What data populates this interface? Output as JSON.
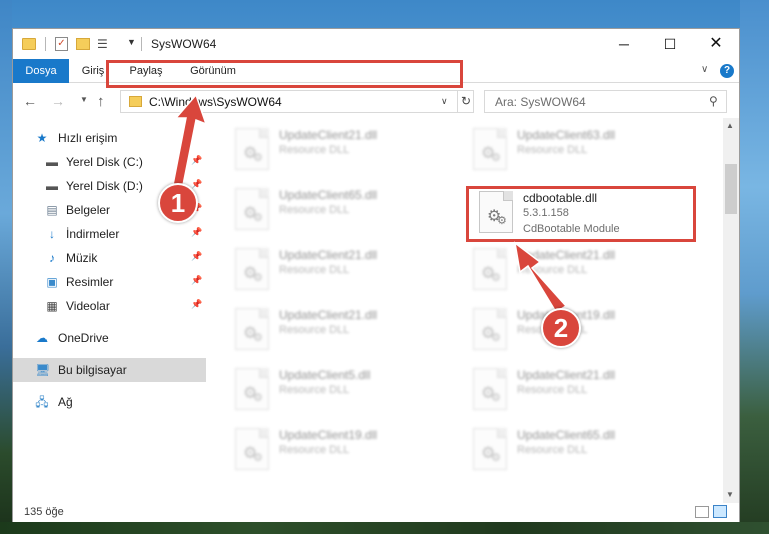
{
  "window": {
    "title": "SysWOW64",
    "minimize_glyph": "─",
    "maximize_glyph": "☐",
    "close_glyph": "✕"
  },
  "ribbon": {
    "tabs": [
      "Dosya",
      "Giriş",
      "Paylaş",
      "Görünüm"
    ],
    "help_glyph": "?"
  },
  "navigation": {
    "address": "C:\\Windows\\SysWOW64",
    "search_placeholder": "Ara: SysWOW64"
  },
  "sidebar": {
    "items": [
      {
        "label": "Hızlı erişim",
        "icon": "star-icon"
      },
      {
        "label": "Yerel Disk (C:)",
        "icon": "drive-icon",
        "pinned": true
      },
      {
        "label": "Yerel Disk (D:)",
        "icon": "drive-icon",
        "pinned": true
      },
      {
        "label": "Belgeler",
        "icon": "documents-icon",
        "pinned": true
      },
      {
        "label": "İndirmeler",
        "icon": "downloads-icon",
        "pinned": true
      },
      {
        "label": "Müzik",
        "icon": "music-icon",
        "pinned": true
      },
      {
        "label": "Resimler",
        "icon": "pictures-icon",
        "pinned": true
      },
      {
        "label": "Videolar",
        "icon": "videos-icon",
        "pinned": true
      },
      {
        "label": "OneDrive",
        "icon": "onedrive-icon"
      },
      {
        "label": "Bu bilgisayar",
        "icon": "computer-icon",
        "selected": true
      },
      {
        "label": "Ağ",
        "icon": "network-icon"
      }
    ]
  },
  "files": [
    {
      "name": "UpdateClient21.dll",
      "type": "Resource DLL"
    },
    {
      "name": "UpdateClient63.dll",
      "type": "Resource DLL"
    },
    {
      "name": "UpdateClient65.dll",
      "type": "Resource DLL"
    },
    {
      "name": "cdbootable.dll",
      "type": "5.3.1.158",
      "desc": "CdBootable Module",
      "highlighted": true
    },
    {
      "name": "UpdateClient21.dll",
      "type": "Resource DLL"
    },
    {
      "name": "UpdateClient21.dll",
      "type": "Resource DLL"
    },
    {
      "name": "UpdateClient21.dll",
      "type": "Resource DLL"
    },
    {
      "name": "UpdateClient19.dll",
      "type": "Resource DLL"
    },
    {
      "name": "UpdateClient5.dll",
      "type": "Resource DLL"
    },
    {
      "name": "UpdateClient21.dll",
      "type": "Resource DLL"
    },
    {
      "name": "UpdateClient19.dll",
      "type": "Resource DLL"
    },
    {
      "name": "UpdateClient65.dll",
      "type": "Resource DLL"
    }
  ],
  "status": {
    "item_count": "135 öğe"
  },
  "callouts": [
    "1",
    "2"
  ],
  "colors": {
    "accent": "#1979ca",
    "highlight_red": "#d9463c",
    "selected_bg": "#d9d9d9"
  }
}
